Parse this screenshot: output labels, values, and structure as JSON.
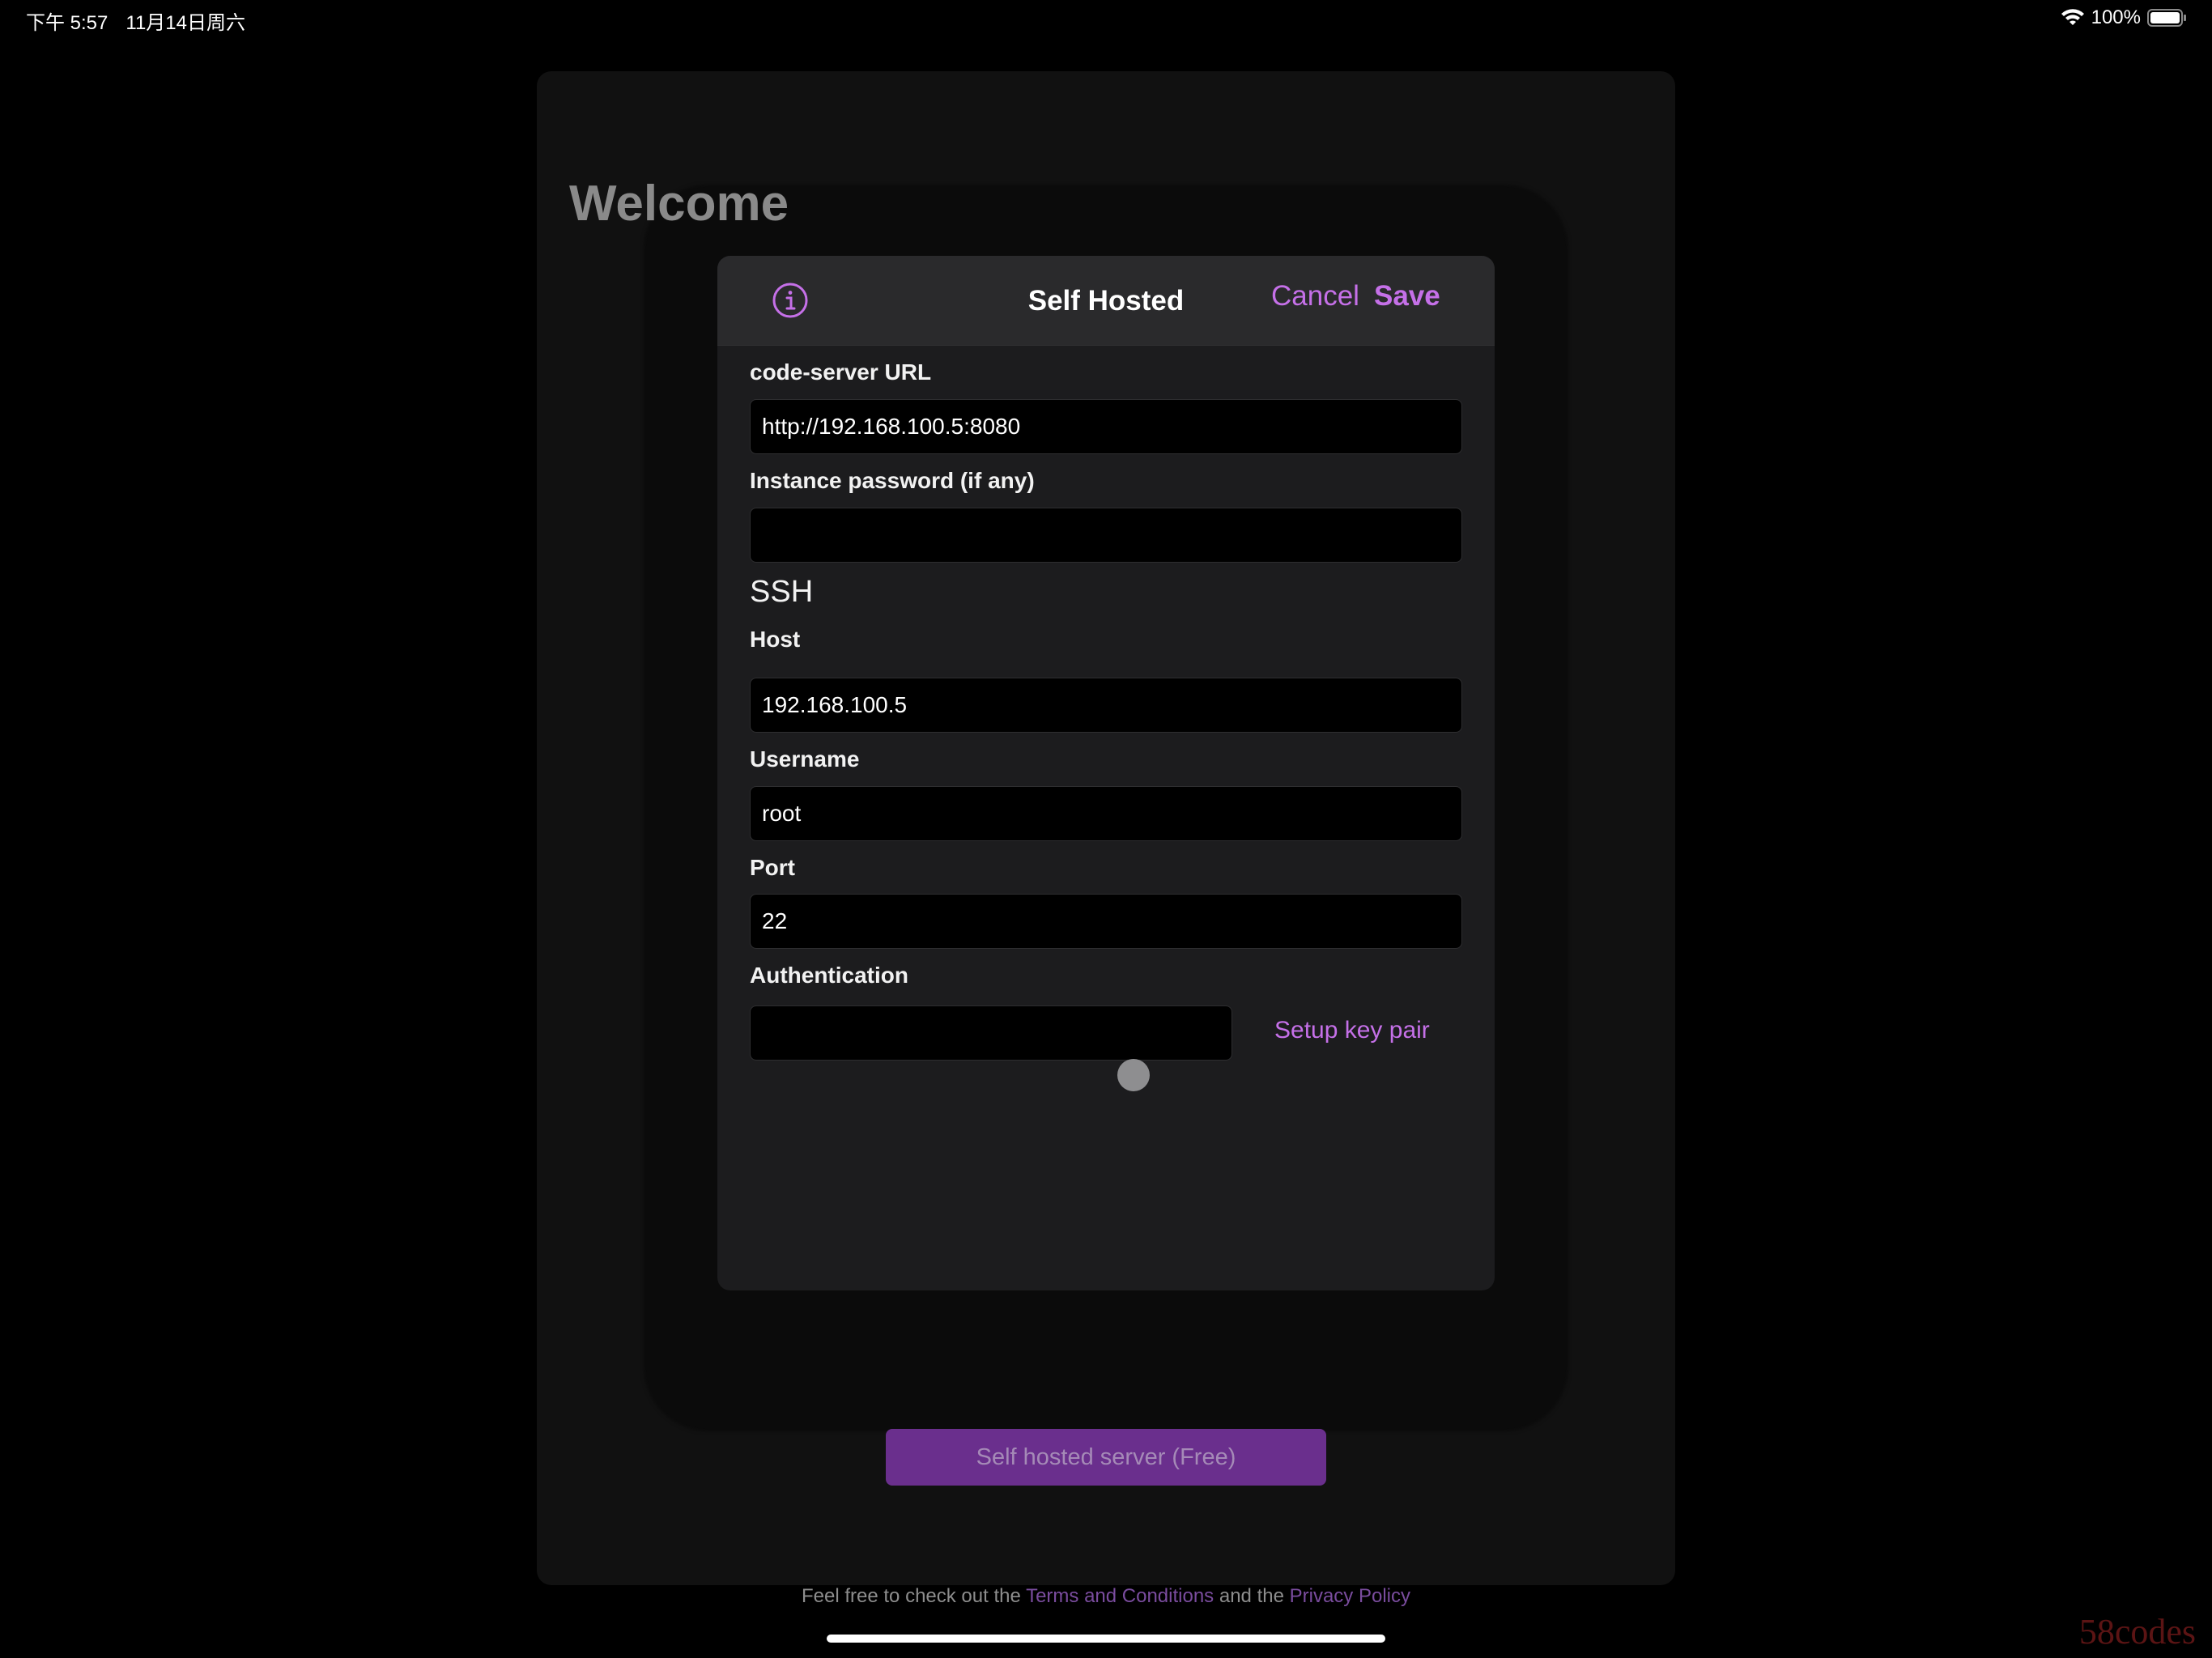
{
  "status_bar": {
    "time": "下午 5:57",
    "date": "11月14日周六",
    "battery": "100%"
  },
  "background": {
    "title": "Welcome",
    "primary_button": "Self hosted server (Free)",
    "footer": {
      "prefix": "Feel free to check out the ",
      "terms_link": "Terms and Conditions",
      "middle": " and the ",
      "privacy_link": "Privacy Policy"
    }
  },
  "modal": {
    "title": "Self Hosted",
    "cancel_label": "Cancel",
    "save_label": "Save",
    "fields": {
      "url_label": "code-server URL",
      "url_value": "http://192.168.100.5:8080",
      "password_label": "Instance password (if any)",
      "password_value": "",
      "ssh_section": "SSH",
      "host_label": "Host",
      "host_value": "192.168.100.5",
      "username_label": "Username",
      "username_value": "root",
      "port_label": "Port",
      "port_value": "22",
      "auth_label": "Authentication",
      "auth_value": ""
    },
    "setup_key_label": "Setup key pair"
  },
  "watermark": "58codes",
  "colors": {
    "accent": "#c570e8",
    "primary_button_bg": "#6a2f8d",
    "modal_bg": "#1c1c1e",
    "header_bg": "#2a2a2c",
    "page_bg": "#000000"
  },
  "icons": {
    "info": "info-circle-icon",
    "wifi": "wifi-icon",
    "battery": "battery-icon"
  }
}
